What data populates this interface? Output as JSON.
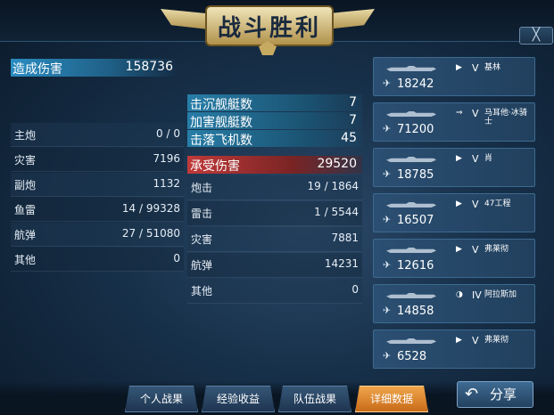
{
  "header": {
    "title": "战斗胜利",
    "close_label": "╳"
  },
  "summary": {
    "damage_label": "造成伤害",
    "damage_value": "158736"
  },
  "kills": [
    {
      "label": "击沉舰艇数",
      "value": "7"
    },
    {
      "label": "加害舰艇数",
      "value": "7"
    },
    {
      "label": "击落飞机数",
      "value": "45"
    }
  ],
  "damage_breakdown": [
    {
      "label": "主炮",
      "value": "0 / 0"
    },
    {
      "label": "灾害",
      "value": "7196"
    },
    {
      "label": "副炮",
      "value": "1132"
    },
    {
      "label": "鱼雷",
      "value": "14 / 99328"
    },
    {
      "label": "航弹",
      "value": "27 / 51080"
    },
    {
      "label": "其他",
      "value": "0"
    }
  ],
  "taken": {
    "label": "承受伤害",
    "value": "29520",
    "rows": [
      {
        "label": "炮击",
        "value": "19 / 1864"
      },
      {
        "label": "雷击",
        "value": "1 / 5544"
      },
      {
        "label": "灾害",
        "value": "7881"
      },
      {
        "label": "航弹",
        "value": "14231"
      },
      {
        "label": "其他",
        "value": "0"
      }
    ]
  },
  "ships": [
    {
      "value": "18242",
      "rank": "V",
      "name": "基林",
      "icon": "play-icon",
      "type": "destroyer"
    },
    {
      "value": "71200",
      "rank": "V",
      "name": "马耳他·冰骑士",
      "icon": "double-arrow-icon",
      "type": "carrier"
    },
    {
      "value": "18785",
      "rank": "V",
      "name": "肖",
      "icon": "play-icon",
      "type": "destroyer"
    },
    {
      "value": "16507",
      "rank": "V",
      "name": "47工程",
      "icon": "play-icon",
      "type": "destroyer"
    },
    {
      "value": "12616",
      "rank": "V",
      "name": "弗莱彻",
      "icon": "play-icon",
      "type": "destroyer"
    },
    {
      "value": "14858",
      "rank": "IV",
      "name": "阿拉斯加",
      "icon": "eye-slash-icon",
      "type": "cruiser"
    },
    {
      "value": "6528",
      "rank": "V",
      "name": "弗莱彻",
      "icon": "play-icon",
      "type": "destroyer"
    }
  ],
  "tabs": [
    {
      "label": "个人战果",
      "active": false
    },
    {
      "label": "经验收益",
      "active": false
    },
    {
      "label": "队伍战果",
      "active": false
    },
    {
      "label": "详细数据",
      "active": true
    }
  ],
  "share": {
    "label": "分享",
    "icon": "share-arrow-icon"
  },
  "colors": {
    "damage_bar": "#2a8cc0",
    "taken_bar": "#c03a3a",
    "active_tab": "#e6892c"
  }
}
